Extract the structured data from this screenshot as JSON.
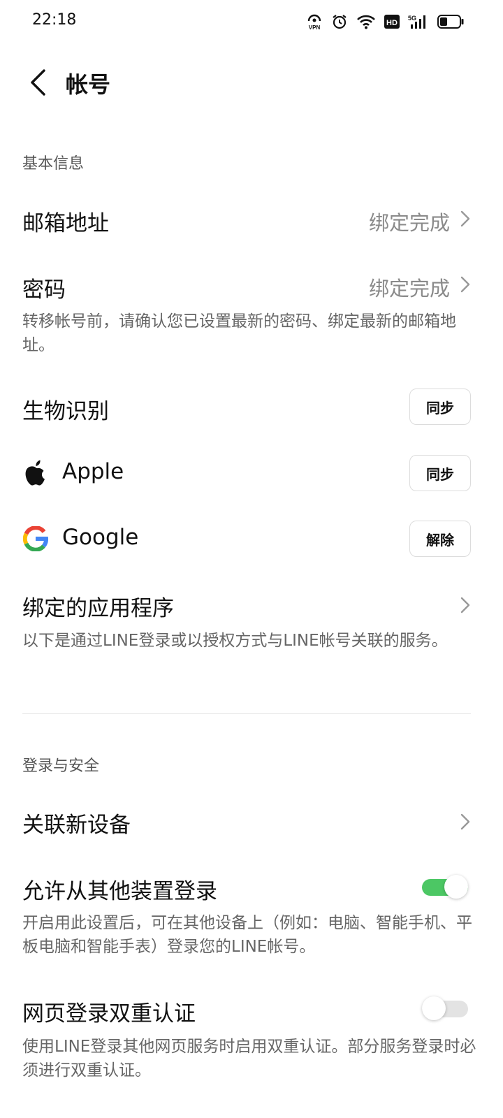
{
  "status_bar": {
    "time": "22:18",
    "icons": [
      "vpn-icon",
      "alarm-icon",
      "wifi-icon",
      "hd-icon",
      "5g-signal-icon",
      "battery-icon"
    ],
    "vpn_label": "VPN",
    "hd_label": "HD",
    "network_label": "5G"
  },
  "header": {
    "title": "帐号"
  },
  "basic_info": {
    "section_label": "基本信息",
    "email": {
      "label": "邮箱地址",
      "value": "绑定完成"
    },
    "password": {
      "label": "密码",
      "value": "绑定完成"
    },
    "note": "转移帐号前，请确认您已设置最新的密码、绑定最新的邮箱地址。",
    "biometric": {
      "label": "生物识别",
      "button": "同步"
    },
    "apple": {
      "label": "Apple",
      "button": "同步"
    },
    "google": {
      "label": "Google",
      "button": "解除"
    },
    "linked_apps": {
      "label": "绑定的应用程序",
      "desc": "以下是通过LINE登录或以授权方式与LINE帐号关联的服务。"
    }
  },
  "login_security": {
    "section_label": "登录与安全",
    "link_device": {
      "label": "关联新设备"
    },
    "allow_other_login": {
      "label": "允许从其他装置登录",
      "enabled": true,
      "desc": "开启用此设置后，可在其他设备上（例如：电脑、智能手机、平板电脑和智能手表）登录您的LINE帐号。"
    },
    "web_2fa": {
      "label": "网页登录双重认证",
      "enabled": false,
      "desc": "使用LINE登录其他网页服务时启用双重认证。部分服务登录时必须进行双重认证。"
    }
  },
  "colors": {
    "toggle_on": "#4cc764",
    "toggle_off": "#e3e3e3",
    "secondary_text": "#8a8a8a"
  }
}
